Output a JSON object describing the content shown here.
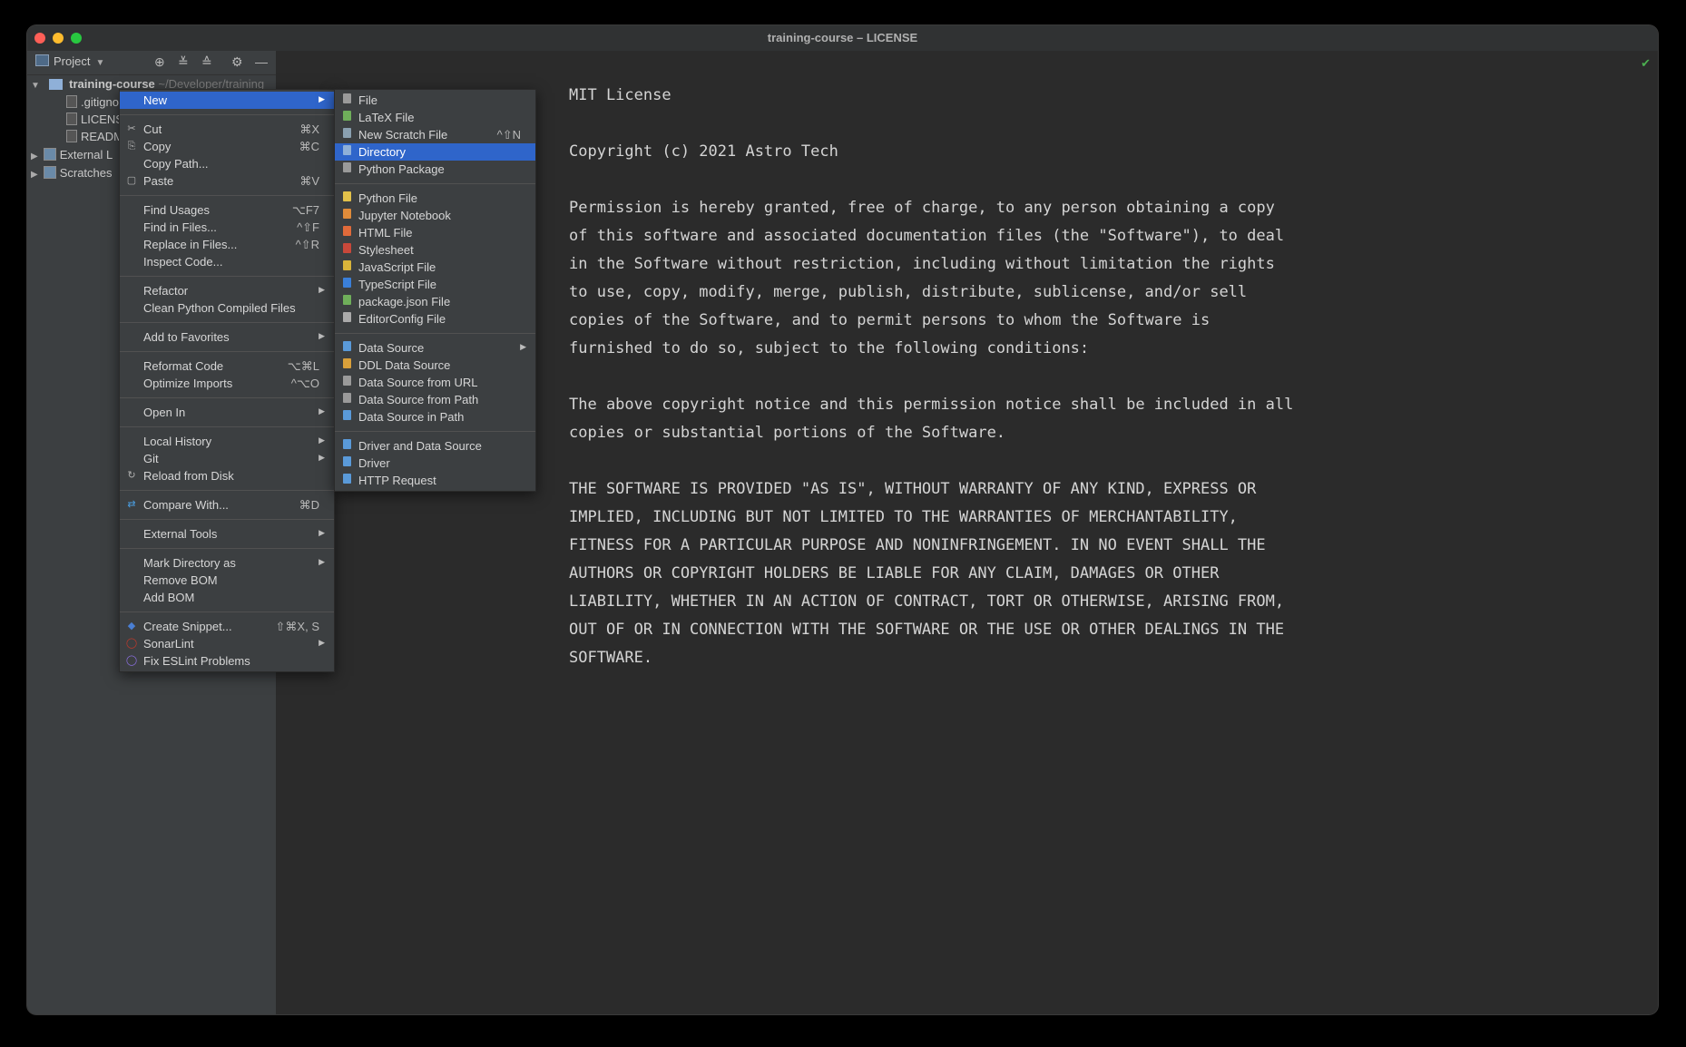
{
  "window": {
    "title": "training-course – LICENSE"
  },
  "project_toolbar": {
    "label": "Project"
  },
  "tree": {
    "root": {
      "name": "training-course",
      "path": "~/Developer/training"
    },
    "items": [
      ".gitignore",
      "LICENSE",
      "README",
      "External L",
      "Scratches"
    ]
  },
  "license_text": "MIT License\n\nCopyright (c) 2021 Astro Tech\n\nPermission is hereby granted, free of charge, to any person obtaining a copy\nof this software and associated documentation files (the \"Software\"), to deal\nin the Software without restriction, including without limitation the rights\nto use, copy, modify, merge, publish, distribute, sublicense, and/or sell\ncopies of the Software, and to permit persons to whom the Software is\nfurnished to do so, subject to the following conditions:\n\nThe above copyright notice and this permission notice shall be included in all\ncopies or substantial portions of the Software.\n\nTHE SOFTWARE IS PROVIDED \"AS IS\", WITHOUT WARRANTY OF ANY KIND, EXPRESS OR\nIMPLIED, INCLUDING BUT NOT LIMITED TO THE WARRANTIES OF MERCHANTABILITY,\nFITNESS FOR A PARTICULAR PURPOSE AND NONINFRINGEMENT. IN NO EVENT SHALL THE\nAUTHORS OR COPYRIGHT HOLDERS BE LIABLE FOR ANY CLAIM, DAMAGES OR OTHER\nLIABILITY, WHETHER IN AN ACTION OF CONTRACT, TORT OR OTHERWISE, ARISING FROM,\nOUT OF OR IN CONNECTION WITH THE SOFTWARE OR THE USE OR OTHER DEALINGS IN THE\nSOFTWARE.",
  "context_menu": {
    "items": [
      {
        "label": "New",
        "submenu": true,
        "selected": true
      },
      {
        "sep": true
      },
      {
        "label": "Cut",
        "shortcut": "⌘X",
        "icon": "✂"
      },
      {
        "label": "Copy",
        "shortcut": "⌘C",
        "icon": "⎘"
      },
      {
        "label": "Copy Path..."
      },
      {
        "label": "Paste",
        "shortcut": "⌘V",
        "icon": "▢"
      },
      {
        "sep": true
      },
      {
        "label": "Find Usages",
        "shortcut": "⌥F7"
      },
      {
        "label": "Find in Files...",
        "shortcut": "^⇧F"
      },
      {
        "label": "Replace in Files...",
        "shortcut": "^⇧R"
      },
      {
        "label": "Inspect Code..."
      },
      {
        "sep": true
      },
      {
        "label": "Refactor",
        "submenu": true
      },
      {
        "label": "Clean Python Compiled Files"
      },
      {
        "sep": true
      },
      {
        "label": "Add to Favorites",
        "submenu": true
      },
      {
        "sep": true
      },
      {
        "label": "Reformat Code",
        "shortcut": "⌥⌘L"
      },
      {
        "label": "Optimize Imports",
        "shortcut": "^⌥O"
      },
      {
        "sep": true
      },
      {
        "label": "Open In",
        "submenu": true
      },
      {
        "sep": true
      },
      {
        "label": "Local History",
        "submenu": true
      },
      {
        "label": "Git",
        "submenu": true
      },
      {
        "label": "Reload from Disk",
        "icon": "↻"
      },
      {
        "sep": true
      },
      {
        "label": "Compare With...",
        "shortcut": "⌘D",
        "icon": "⇄",
        "icon_color": "#4a9de0"
      },
      {
        "sep": true
      },
      {
        "label": "External Tools",
        "submenu": true
      },
      {
        "sep": true
      },
      {
        "label": "Mark Directory as",
        "submenu": true
      },
      {
        "label": "Remove BOM"
      },
      {
        "label": "Add BOM"
      },
      {
        "sep": true
      },
      {
        "label": "Create Snippet...",
        "shortcut": "⇧⌘X, S",
        "icon": "◆",
        "icon_color": "#4a7fd4"
      },
      {
        "label": "SonarLint",
        "submenu": true,
        "icon": "◯",
        "icon_color": "#c0392b"
      },
      {
        "label": "Fix ESLint Problems",
        "icon": "◯",
        "icon_color": "#8b6fe0"
      }
    ]
  },
  "new_submenu": {
    "items": [
      {
        "label": "File",
        "icon_color": "#9a9a9a"
      },
      {
        "label": "LaTeX File",
        "icon_color": "#6fae5a"
      },
      {
        "label": "New Scratch File",
        "shortcut": "^⇧N",
        "icon_color": "#8aa0b0"
      },
      {
        "label": "Directory",
        "selected": true,
        "icon_color": "#8fb0d8"
      },
      {
        "label": "Python Package",
        "icon_color": "#9a9a9a"
      },
      {
        "sep": true
      },
      {
        "label": "Python File",
        "icon_color": "#e2c14a"
      },
      {
        "label": "Jupyter Notebook",
        "icon_color": "#e08c3a"
      },
      {
        "label": "HTML File",
        "icon_color": "#e06a3a"
      },
      {
        "label": "Stylesheet",
        "icon_color": "#c8483a"
      },
      {
        "label": "JavaScript File",
        "icon_color": "#d9b43a"
      },
      {
        "label": "TypeScript File",
        "icon_color": "#3a7fd9"
      },
      {
        "label": "package.json File",
        "icon_color": "#6fae5a"
      },
      {
        "label": "EditorConfig File",
        "icon_color": "#aaaaaa"
      },
      {
        "sep": true
      },
      {
        "label": "Data Source",
        "submenu": true,
        "icon_color": "#5a9ad9"
      },
      {
        "label": "DDL Data Source",
        "icon_color": "#d9a03a"
      },
      {
        "label": "Data Source from URL",
        "icon_color": "#9a9a9a"
      },
      {
        "label": "Data Source from Path",
        "icon_color": "#9a9a9a"
      },
      {
        "label": "Data Source in Path",
        "icon_color": "#5a9ad9"
      },
      {
        "sep": true
      },
      {
        "label": "Driver and Data Source",
        "icon_color": "#5a9ad9"
      },
      {
        "label": "Driver",
        "icon_color": "#5a9ad9"
      },
      {
        "label": "HTTP Request",
        "icon_color": "#5a9ad9"
      }
    ]
  }
}
